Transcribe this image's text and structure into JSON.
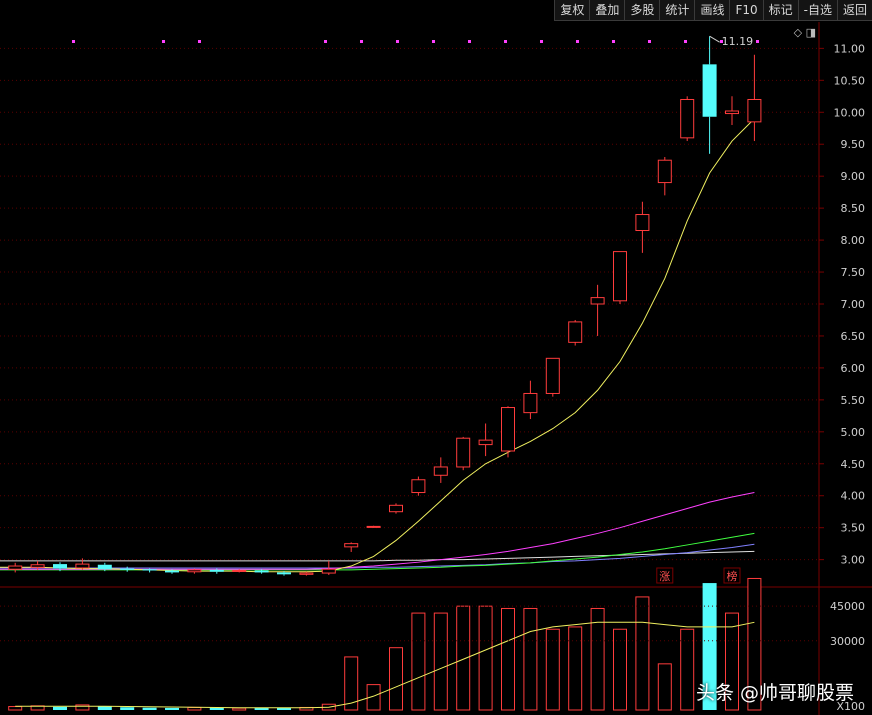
{
  "toolbar": {
    "buttons": [
      "复权",
      "叠加",
      "多股",
      "统计",
      "画线",
      "F10",
      "标记",
      "-自选",
      "返回"
    ]
  },
  "corner_icons": "◇ ◨",
  "watermark": "头条 @帅哥聊股票",
  "volume_unit": "X100",
  "colors": {
    "up": "#ff3c3c",
    "down": "#54fcfc",
    "ma5": "#f0f060",
    "ma10": "#ff40ff",
    "ma20": "#40ff40",
    "ma60": "#8080ff",
    "ma_white": "#e0e0e0",
    "marker": "#ff40ff",
    "grid": "#5a0000"
  },
  "chart_data": [
    {
      "type": "candlestick",
      "y_ticks": [
        "11.00",
        "10.50",
        "10.00",
        "9.50",
        "9.00",
        "8.50",
        "8.00",
        "7.50",
        "7.00",
        "6.50",
        "6.00",
        "5.50",
        "5.00",
        "4.50",
        "4.00",
        "3.50",
        "3.00"
      ],
      "ylim": [
        2.65,
        11.35
      ],
      "max_label": "11.19",
      "tags": [
        {
          "text": "涨",
          "index": 29
        },
        {
          "text": "榜",
          "index": 32
        }
      ],
      "candles": [
        {
          "o": 2.85,
          "c": 2.9,
          "h": 2.95,
          "l": 2.8
        },
        {
          "o": 2.88,
          "c": 2.92,
          "h": 2.98,
          "l": 2.84
        },
        {
          "o": 2.93,
          "c": 2.86,
          "h": 2.96,
          "l": 2.82
        },
        {
          "o": 2.87,
          "c": 2.93,
          "h": 3.02,
          "l": 2.84
        },
        {
          "o": 2.92,
          "c": 2.85,
          "h": 2.95,
          "l": 2.82
        },
        {
          "o": 2.86,
          "c": 2.84,
          "h": 2.89,
          "l": 2.81
        },
        {
          "o": 2.85,
          "c": 2.83,
          "h": 2.86,
          "l": 2.8
        },
        {
          "o": 2.83,
          "c": 2.8,
          "h": 2.85,
          "l": 2.78
        },
        {
          "o": 2.81,
          "c": 2.84,
          "h": 2.86,
          "l": 2.78
        },
        {
          "o": 2.84,
          "c": 2.81,
          "h": 2.86,
          "l": 2.78
        },
        {
          "o": 2.82,
          "c": 2.83,
          "h": 2.85,
          "l": 2.8
        },
        {
          "o": 2.83,
          "c": 2.8,
          "h": 2.85,
          "l": 2.78
        },
        {
          "o": 2.8,
          "c": 2.77,
          "h": 2.82,
          "l": 2.75
        },
        {
          "o": 2.77,
          "c": 2.79,
          "h": 2.81,
          "l": 2.75
        },
        {
          "o": 2.79,
          "c": 2.85,
          "h": 2.98,
          "l": 2.76
        },
        {
          "o": 3.2,
          "c": 3.25,
          "h": 3.27,
          "l": 3.12
        },
        {
          "o": 3.52,
          "c": 3.52,
          "h": 3.53,
          "l": 3.5
        },
        {
          "o": 3.75,
          "c": 3.85,
          "h": 3.88,
          "l": 3.72
        },
        {
          "o": 4.05,
          "c": 4.25,
          "h": 4.3,
          "l": 4.0
        },
        {
          "o": 4.32,
          "c": 4.45,
          "h": 4.6,
          "l": 4.2
        },
        {
          "o": 4.45,
          "c": 4.9,
          "h": 4.92,
          "l": 4.4
        },
        {
          "o": 4.8,
          "c": 4.87,
          "h": 5.13,
          "l": 4.62
        },
        {
          "o": 4.7,
          "c": 5.38,
          "h": 5.4,
          "l": 4.6
        },
        {
          "o": 5.3,
          "c": 5.6,
          "h": 5.8,
          "l": 5.2
        },
        {
          "o": 5.6,
          "c": 6.15,
          "h": 6.15,
          "l": 5.55
        },
        {
          "o": 6.4,
          "c": 6.72,
          "h": 6.75,
          "l": 6.35
        },
        {
          "o": 7.0,
          "c": 7.1,
          "h": 7.3,
          "l": 6.5
        },
        {
          "o": 7.05,
          "c": 7.82,
          "h": 7.82,
          "l": 7.0
        },
        {
          "o": 8.15,
          "c": 8.4,
          "h": 8.6,
          "l": 7.8
        },
        {
          "o": 8.9,
          "c": 9.25,
          "h": 9.3,
          "l": 8.7
        },
        {
          "o": 9.6,
          "c": 10.2,
          "h": 10.25,
          "l": 9.55
        },
        {
          "o": 10.75,
          "c": 9.93,
          "h": 11.19,
          "l": 9.35
        },
        {
          "o": 9.98,
          "c": 10.02,
          "h": 10.25,
          "l": 9.8
        },
        {
          "o": 9.85,
          "c": 10.2,
          "h": 10.9,
          "l": 9.55
        }
      ],
      "ma_series": [
        {
          "key": "ma_white",
          "values": [
            2.98,
            2.98,
            2.98,
            2.98,
            2.98,
            2.98,
            2.98,
            2.98,
            2.98,
            2.98,
            2.98,
            2.98,
            2.98,
            2.98,
            2.98,
            2.98,
            2.98,
            2.99,
            2.99,
            3.0,
            3.0,
            3.01,
            3.02,
            3.03,
            3.04,
            3.05,
            3.06,
            3.07,
            3.08,
            3.09,
            3.1,
            3.11,
            3.12,
            3.13
          ]
        },
        {
          "key": "ma60",
          "values": [
            2.87,
            2.87,
            2.87,
            2.87,
            2.87,
            2.87,
            2.87,
            2.87,
            2.87,
            2.87,
            2.87,
            2.87,
            2.87,
            2.87,
            2.87,
            2.87,
            2.88,
            2.88,
            2.89,
            2.9,
            2.91,
            2.92,
            2.94,
            2.95,
            2.97,
            2.98,
            3.0,
            3.02,
            3.05,
            3.08,
            3.11,
            3.15,
            3.19,
            3.24
          ]
        },
        {
          "key": "ma20",
          "values": [
            2.84,
            2.84,
            2.84,
            2.84,
            2.84,
            2.84,
            2.84,
            2.84,
            2.84,
            2.84,
            2.84,
            2.84,
            2.84,
            2.84,
            2.84,
            2.84,
            2.85,
            2.86,
            2.87,
            2.88,
            2.9,
            2.91,
            2.93,
            2.95,
            2.98,
            3.01,
            3.04,
            3.08,
            3.12,
            3.17,
            3.23,
            3.29,
            3.35,
            3.41
          ]
        },
        {
          "key": "ma10",
          "values": [
            2.85,
            2.85,
            2.85,
            2.85,
            2.85,
            2.85,
            2.85,
            2.85,
            2.85,
            2.85,
            2.85,
            2.85,
            2.85,
            2.85,
            2.86,
            2.88,
            2.9,
            2.93,
            2.96,
            3.0,
            3.04,
            3.08,
            3.13,
            3.19,
            3.25,
            3.33,
            3.41,
            3.5,
            3.6,
            3.7,
            3.8,
            3.9,
            3.98,
            4.05
          ]
        },
        {
          "key": "ma5",
          "values": [
            2.88,
            2.88,
            2.87,
            2.86,
            2.86,
            2.85,
            2.84,
            2.83,
            2.82,
            2.82,
            2.82,
            2.81,
            2.81,
            2.81,
            2.82,
            2.9,
            3.05,
            3.3,
            3.6,
            3.92,
            4.24,
            4.5,
            4.68,
            4.85,
            5.05,
            5.3,
            5.65,
            6.1,
            6.7,
            7.4,
            8.3,
            9.05,
            9.55,
            9.9
          ]
        }
      ]
    },
    {
      "type": "bar",
      "y_ticks": [
        "45000",
        "30000"
      ],
      "ylim": [
        0,
        52000
      ],
      "volumes": [
        1500,
        1800,
        1400,
        2200,
        1600,
        1200,
        1000,
        900,
        1100,
        1000,
        800,
        900,
        1000,
        1100,
        2500,
        23000,
        11000,
        27000,
        42000,
        42000,
        45000,
        45000,
        44000,
        44000,
        35000,
        36000,
        44000,
        35000,
        49000,
        20000,
        35000,
        55000,
        42000,
        57000
      ],
      "vol_ma": [
        1600,
        1600,
        1600,
        1600,
        1600,
        1500,
        1400,
        1300,
        1200,
        1100,
        1000,
        1000,
        1000,
        1000,
        1200,
        3000,
        6000,
        10000,
        14000,
        18000,
        22000,
        26000,
        30000,
        34000,
        36000,
        37000,
        38000,
        38000,
        38000,
        37000,
        36000,
        36000,
        36000,
        38000
      ]
    }
  ]
}
